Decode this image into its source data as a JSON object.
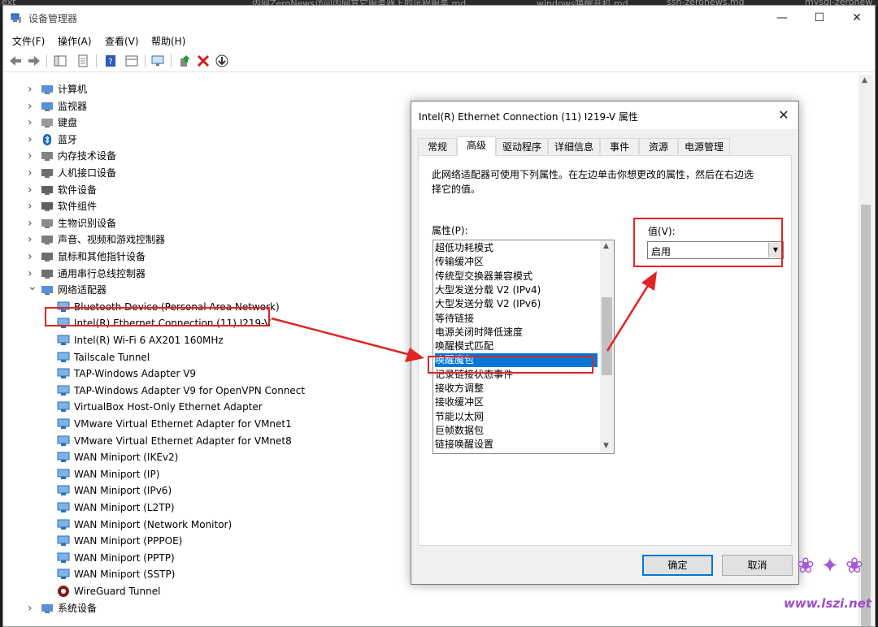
{
  "background_tabs": [
    "ext",
    "内网ZeroNews访问内网其它服务器上的远程服务.md",
    "windows唤醒开机.md",
    "ssh-zeronews.md",
    "mysql-zeronew"
  ],
  "window": {
    "title": "设备管理器",
    "controls": {
      "minimize": "—",
      "maximize": "☐",
      "close": "✕"
    }
  },
  "menu": [
    "文件(F)",
    "操作(A)",
    "查看(V)",
    "帮助(H)"
  ],
  "tree": {
    "categories": [
      {
        "label": "计算机",
        "icon": "computer-icon"
      },
      {
        "label": "监视器",
        "icon": "monitor-icon"
      },
      {
        "label": "键盘",
        "icon": "keyboard-icon"
      },
      {
        "label": "蓝牙",
        "icon": "bluetooth-icon"
      },
      {
        "label": "内存技术设备",
        "icon": "memory-icon"
      },
      {
        "label": "人机接口设备",
        "icon": "hid-icon"
      },
      {
        "label": "软件设备",
        "icon": "software-device-icon"
      },
      {
        "label": "软件组件",
        "icon": "software-component-icon"
      },
      {
        "label": "生物识别设备",
        "icon": "biometric-icon"
      },
      {
        "label": "声音、视频和游戏控制器",
        "icon": "speaker-icon"
      },
      {
        "label": "鼠标和其他指针设备",
        "icon": "mouse-icon"
      },
      {
        "label": "通用串行总线控制器",
        "icon": "usb-icon"
      },
      {
        "label": "网络适配器",
        "icon": "network-icon"
      }
    ],
    "network_adapters": [
      "Bluetooth Device (Personal Area Network)",
      "Intel(R) Ethernet Connection (11) I219-V",
      "Intel(R) Wi-Fi 6 AX201 160MHz",
      "Tailscale Tunnel",
      "TAP-Windows Adapter V9",
      "TAP-Windows Adapter V9 for OpenVPN Connect",
      "VirtualBox Host-Only Ethernet Adapter",
      "VMware Virtual Ethernet Adapter for VMnet1",
      "VMware Virtual Ethernet Adapter for VMnet8",
      "WAN Miniport (IKEv2)",
      "WAN Miniport (IP)",
      "WAN Miniport (IPv6)",
      "WAN Miniport (L2TP)",
      "WAN Miniport (Network Monitor)",
      "WAN Miniport (PPPOE)",
      "WAN Miniport (PPTP)",
      "WAN Miniport (SSTP)",
      "WireGuard Tunnel"
    ],
    "last_category": "系统设备"
  },
  "dialog": {
    "title": "Intel(R) Ethernet Connection (11) I219-V 属性",
    "tabs": [
      "常规",
      "高级",
      "驱动程序",
      "详细信息",
      "事件",
      "资源",
      "电源管理"
    ],
    "active_tab": "高级",
    "description": "此网络适配器可使用下列属性。在左边单击你想更改的属性，然后在右边选择它的值。",
    "property_label": "属性(P):",
    "properties": [
      "超低功耗模式",
      "传输缓冲区",
      "传统型交换器兼容模式",
      "大型发送分载 V2 (IPv4)",
      "大型发送分载 V2 (IPv6)",
      "等待链接",
      "电源关闭时降低速度",
      "唤醒模式匹配",
      "唤醒魔包",
      "记录链接状态事件",
      "接收方调整",
      "接收缓冲区",
      "节能以太网",
      "巨帧数据包",
      "链接唤醒设置"
    ],
    "selected_property": "唤醒魔包",
    "value_label": "值(V):",
    "value": "启用",
    "ok_label": "确定",
    "cancel_label": "取消"
  },
  "watermark": {
    "text": "www.lszi.net"
  },
  "colors": {
    "selection": "#0078d7",
    "annotation_red": "#e02424",
    "watermark": "#9b4cc9"
  }
}
